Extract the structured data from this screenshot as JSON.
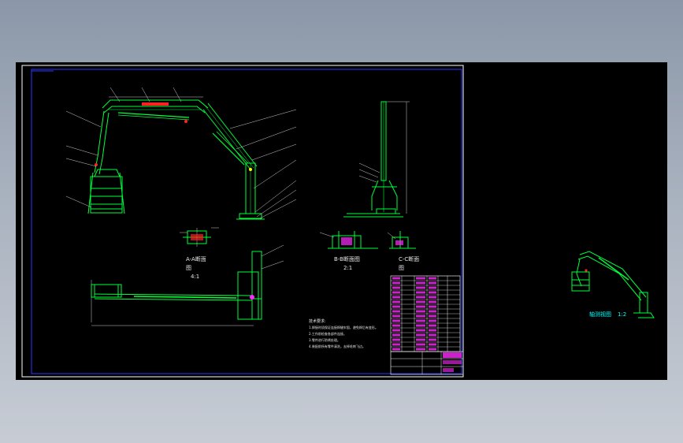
{
  "drawing": {
    "background": "#000000",
    "colors": {
      "frame": "#ffffff",
      "border": "#2b36ff",
      "part": "#00ff3a",
      "dim": "#e6e6e6",
      "leader": "#cccccc",
      "text": "#e6e6e6",
      "accent": "#ff2aff",
      "red": "#ff2020",
      "yellow": "#ffff00",
      "cyan": "#00ffff"
    },
    "views": {
      "section_aa": {
        "title": "A-A断面",
        "title2": "图",
        "scale": "4:1"
      },
      "section_bb": {
        "title": "B-B断面图",
        "scale": "2:1"
      },
      "section_cc": {
        "title": "C-C断面",
        "title2": "图"
      },
      "iso": {
        "title": "轴测视图",
        "scale": "1:2"
      }
    },
    "notes_title": "技术要求:",
    "notes": [
      "1.焊接时须保证连接焊缝牢固，避免焊后有变形。",
      "2.工作前检查各部件连接。",
      "3.零件进行防锈处理。",
      "4.装配前所有零件清洗，去掉毛刺飞边。"
    ]
  }
}
